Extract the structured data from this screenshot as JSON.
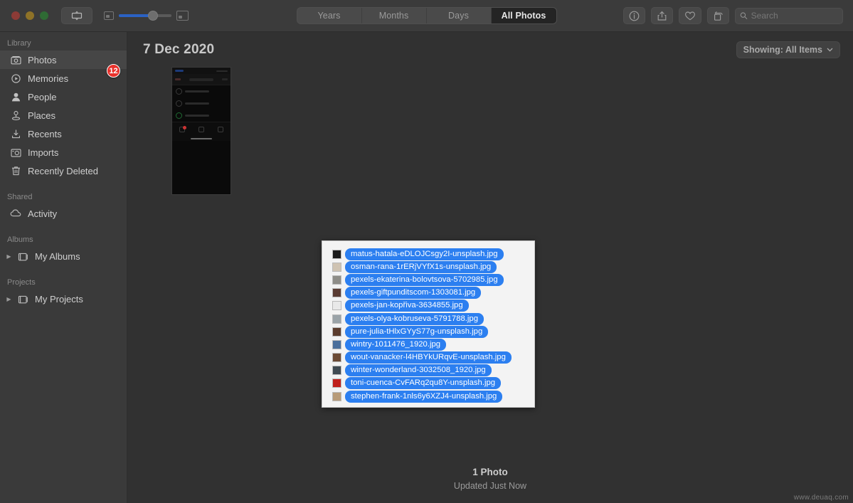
{
  "window": {
    "traffic_lights": [
      "close",
      "minimize",
      "zoom"
    ],
    "watermark": "www.deuaq.com"
  },
  "toolbar": {
    "sidebar_toggle_label": "",
    "zoom_slider": {
      "value": 65,
      "min_icon": "small-image-icon",
      "max_icon": "large-image-icon"
    },
    "segments": [
      {
        "label": "Years",
        "active": false
      },
      {
        "label": "Months",
        "active": false
      },
      {
        "label": "Days",
        "active": false
      },
      {
        "label": "All Photos",
        "active": true
      }
    ],
    "actions": [
      {
        "name": "info-button",
        "icon": "info-icon"
      },
      {
        "name": "share-button",
        "icon": "share-icon"
      },
      {
        "name": "favorite-button",
        "icon": "heart-icon"
      },
      {
        "name": "rotate-button",
        "icon": "rotate-icon"
      }
    ],
    "search": {
      "placeholder": "Search",
      "value": ""
    }
  },
  "sidebar": {
    "groups": [
      {
        "title": "Library",
        "items": [
          {
            "label": "Photos",
            "icon": "photos-icon",
            "selected": true
          },
          {
            "label": "Memories",
            "icon": "memories-icon",
            "selected": false
          },
          {
            "label": "People",
            "icon": "people-icon",
            "selected": false
          },
          {
            "label": "Places",
            "icon": "places-icon",
            "selected": false
          },
          {
            "label": "Recents",
            "icon": "recents-icon",
            "selected": false
          },
          {
            "label": "Imports",
            "icon": "imports-icon",
            "selected": false
          },
          {
            "label": "Recently Deleted",
            "icon": "trash-icon",
            "selected": false
          }
        ]
      },
      {
        "title": "Shared",
        "items": [
          {
            "label": "Activity",
            "icon": "cloud-icon",
            "selected": false
          }
        ]
      },
      {
        "title": "Albums",
        "items": [
          {
            "label": "My Albums",
            "icon": "album-icon",
            "selected": false,
            "disclosure": "▶"
          }
        ]
      },
      {
        "title": "Projects",
        "items": [
          {
            "label": "My Projects",
            "icon": "album-icon",
            "selected": false,
            "disclosure": "▶"
          }
        ]
      }
    ]
  },
  "main": {
    "day_title": "7 Dec 2020",
    "showing_label": "Showing: All Items",
    "showing_chevron": "⌄",
    "photo_count": "1 Photo",
    "updated_text": "Updated Just Now"
  },
  "drag": {
    "badge_count": "12",
    "files": [
      {
        "name": "matus-hatala-eDLOJCsgy2I-unsplash.jpg",
        "thumb_color": "#1b1b1b"
      },
      {
        "name": "osman-rana-1rERjVYfX1s-unsplash.jpg",
        "thumb_color": "#cfc3b2"
      },
      {
        "name": "pexels-ekaterina-bolovtsova-5702985.jpg",
        "thumb_color": "#8e8d88"
      },
      {
        "name": "pexels-giftpunditscom-1303081.jpg",
        "thumb_color": "#5a3c33"
      },
      {
        "name": "pexels-jan-kopřiva-3634855.jpg",
        "thumb_color": "#e9e9e9"
      },
      {
        "name": "pexels-olya-kobruseva-5791788.jpg",
        "thumb_color": "#9aa3a8"
      },
      {
        "name": "pure-julia-tHlxGYyS77g-unsplash.jpg",
        "thumb_color": "#5b3c2d"
      },
      {
        "name": "wintry-1011476_1920.jpg",
        "thumb_color": "#4b6f9c"
      },
      {
        "name": "wout-vanacker-l4HBYkURqvE-unsplash.jpg",
        "thumb_color": "#6b4a35"
      },
      {
        "name": "winter-wonderland-3032508_1920.jpg",
        "thumb_color": "#3f4a52"
      },
      {
        "name": "toni-cuenca-CvFARq2qu8Y-unsplash.jpg",
        "thumb_color": "#c0201c"
      },
      {
        "name": "stephen-frank-1nls6y6XZJ4-unsplash.jpg",
        "thumb_color": "#b89b78"
      }
    ]
  },
  "colors": {
    "selection_blue": "#2c7ff0",
    "badge_red": "#e8322c",
    "slider_blue": "#2b62c4",
    "window_bg": "#3a3a3a"
  }
}
